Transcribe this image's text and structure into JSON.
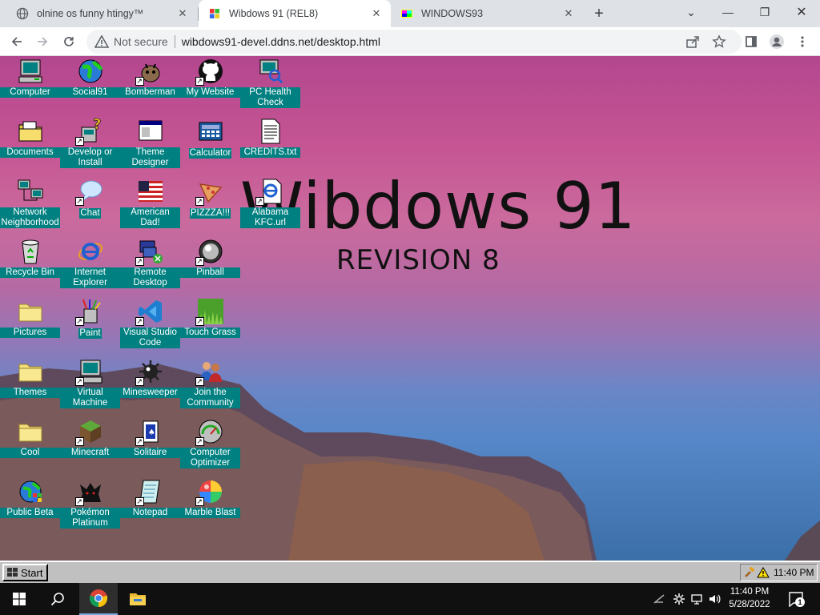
{
  "browser": {
    "tabs": [
      {
        "title": "olnine os funny htingy™"
      },
      {
        "title": "Wibdows 91 (REL8)"
      },
      {
        "title": "WINDOWS93"
      }
    ],
    "not_secure": "Not secure",
    "url": "wibdows91-devel.ddns.net/desktop.html"
  },
  "desktop": {
    "title": "Wibdows 91",
    "subtitle": "REVISION 8",
    "icons": [
      {
        "label": "Computer",
        "icon": "computer-icon"
      },
      {
        "label": "Social91",
        "icon": "globe-icon"
      },
      {
        "label": "Bomberman",
        "icon": "bomberman-icon"
      },
      {
        "label": "My Website",
        "icon": "github-icon"
      },
      {
        "label": "PC Health Check",
        "icon": "health-check-icon"
      },
      {
        "label": "Documents",
        "icon": "folder-documents-icon"
      },
      {
        "label": "Develop or Install",
        "icon": "setup-icon"
      },
      {
        "label": "Theme Designer",
        "icon": "window-icon"
      },
      {
        "label": "Calculator",
        "icon": "calculator-icon"
      },
      {
        "label": "CREDITS.txt",
        "icon": "text-file-icon"
      },
      {
        "label": "Network Neighborhood",
        "icon": "network-icon"
      },
      {
        "label": "Chat",
        "icon": "chat-bubble-icon"
      },
      {
        "label": "American Dad!",
        "icon": "us-flag-icon"
      },
      {
        "label": "PIZZZA!!!",
        "icon": "pizza-icon"
      },
      {
        "label": "Alabama KFC.url",
        "icon": "internet-shortcut-icon"
      },
      {
        "label": "Recycle Bin",
        "icon": "recycle-bin-icon"
      },
      {
        "label": "Internet Explorer",
        "icon": "internet-explorer-icon"
      },
      {
        "label": "Remote Desktop",
        "icon": "remote-desktop-icon"
      },
      {
        "label": "Pinball",
        "icon": "pinball-icon"
      },
      {
        "label": "Pictures",
        "icon": "folder-icon"
      },
      {
        "label": "Paint",
        "icon": "paint-icon"
      },
      {
        "label": "Visual Studio Code",
        "icon": "vscode-icon"
      },
      {
        "label": "Touch Grass",
        "icon": "grass-icon"
      },
      {
        "label": "Themes",
        "icon": "folder-icon"
      },
      {
        "label": "Virtual Machine",
        "icon": "computer-icon"
      },
      {
        "label": "Minesweeper",
        "icon": "mine-icon"
      },
      {
        "label": "Join the Community",
        "icon": "people-icon"
      },
      {
        "label": "Cool",
        "icon": "folder-icon"
      },
      {
        "label": "Minecraft",
        "icon": "minecraft-block-icon"
      },
      {
        "label": "Solitaire",
        "icon": "cards-icon"
      },
      {
        "label": "Computer Optimizer",
        "icon": "gauge-icon"
      },
      {
        "label": "Public Beta",
        "icon": "globe-windows-icon"
      },
      {
        "label": "Pokémon Platinum",
        "icon": "pokemon-icon"
      },
      {
        "label": "Notepad",
        "icon": "notepad-icon"
      },
      {
        "label": "Marble Blast",
        "icon": "marble-icon"
      }
    ]
  },
  "w91_taskbar": {
    "start_label": "Start",
    "time": "11:40 PM"
  },
  "win10_taskbar": {
    "time": "11:40 PM",
    "date": "5/28/2022",
    "notification_count": "1"
  }
}
